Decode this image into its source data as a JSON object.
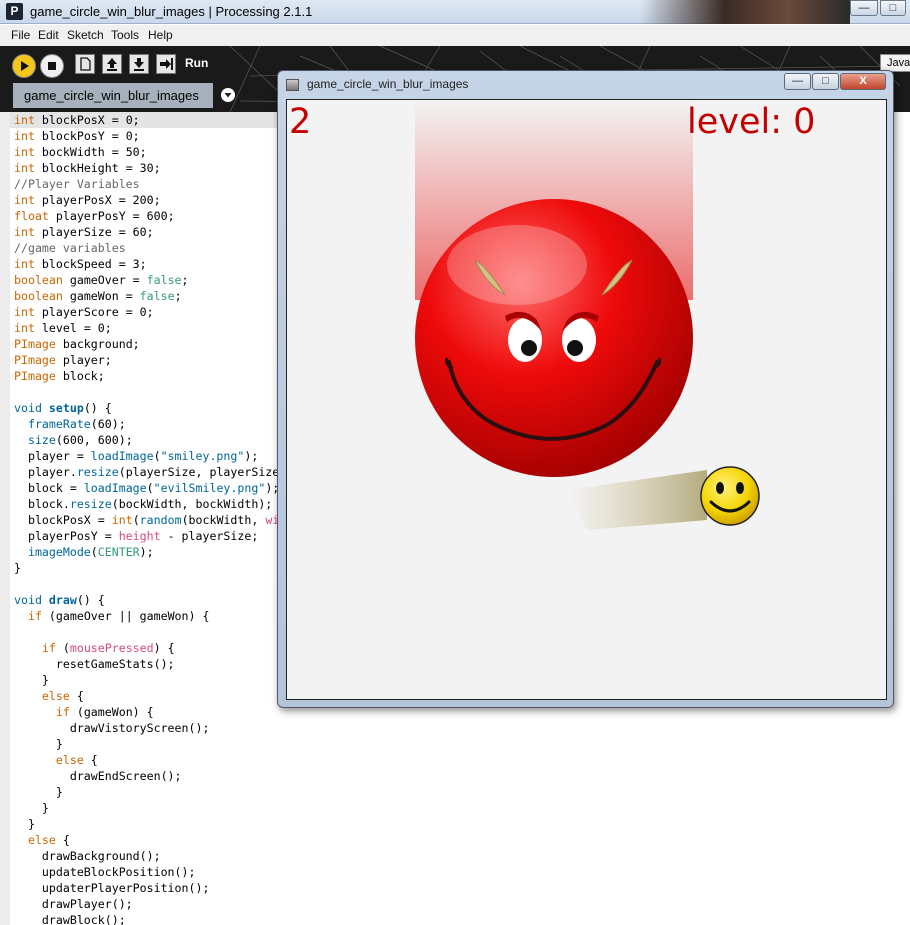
{
  "titlebar": {
    "title": "game_circle_win_blur_images | Processing 2.1.1"
  },
  "window_controls": {
    "minimize": "—",
    "maximize": "□"
  },
  "menu": [
    "File",
    "Edit",
    "Sketch",
    "Tools",
    "Help"
  ],
  "toolbar": {
    "run_label": "Run",
    "mode_label": "Java",
    "tab_label": "game_circle_win_blur_images"
  },
  "sketch_window": {
    "title": "game_circle_win_blur_images",
    "score": "2",
    "level": "level: 0",
    "minimize": "—",
    "maximize": "□",
    "close": "X"
  },
  "colors": {
    "score_text": "#c40000",
    "enemy_red": "#e60000",
    "player_yellow": "#f5d400",
    "canvas_bg": "#f3f3f3"
  },
  "icons": [
    "run-icon",
    "stop-icon",
    "new-icon",
    "open-icon",
    "save-icon",
    "export-icon",
    "tab-dropdown-icon",
    "evil-smiley",
    "smiley"
  ],
  "code": [
    "int blockPosX = 0;",
    "int blockPosY = 0;",
    "int bockWidth = 50;",
    "int blockHeight = 30;",
    "//Player Variables",
    "int playerPosX = 200;",
    "float playerPosY = 600;",
    "int playerSize = 60;",
    "//game variables",
    "int blockSpeed = 3;",
    "boolean gameOver = false;",
    "boolean gameWon = false;",
    "int playerScore = 0;",
    "int level = 0;",
    "PImage background;",
    "PImage player;",
    "PImage block;",
    "",
    "void setup() {",
    "  frameRate(60);",
    "  size(600, 600);",
    "  player = loadImage(\"smiley.png\");",
    "  player.resize(playerSize, playerSize);",
    "  block = loadImage(\"evilSmiley.png\");",
    "  block.resize(bockWidth, bockWidth);",
    "  blockPosX = int(random(bockWidth, width - bockWidth));",
    "  playerPosY = height - playerSize;",
    "  imageMode(CENTER);",
    "}",
    "",
    "void draw() {",
    "  if (gameOver || gameWon) {",
    "",
    "    if (mousePressed) {",
    "      resetGameStats();",
    "    }",
    "    else {",
    "      if (gameWon) {",
    "        drawVistoryScreen();",
    "      }",
    "      else {",
    "        drawEndScreen();",
    "      }",
    "    }",
    "  }",
    "  else {",
    "    drawBackground();",
    "    updateBlockPosition();",
    "    updaterPlayerPosition();",
    "    drawPlayer();",
    "    drawBlock();"
  ]
}
